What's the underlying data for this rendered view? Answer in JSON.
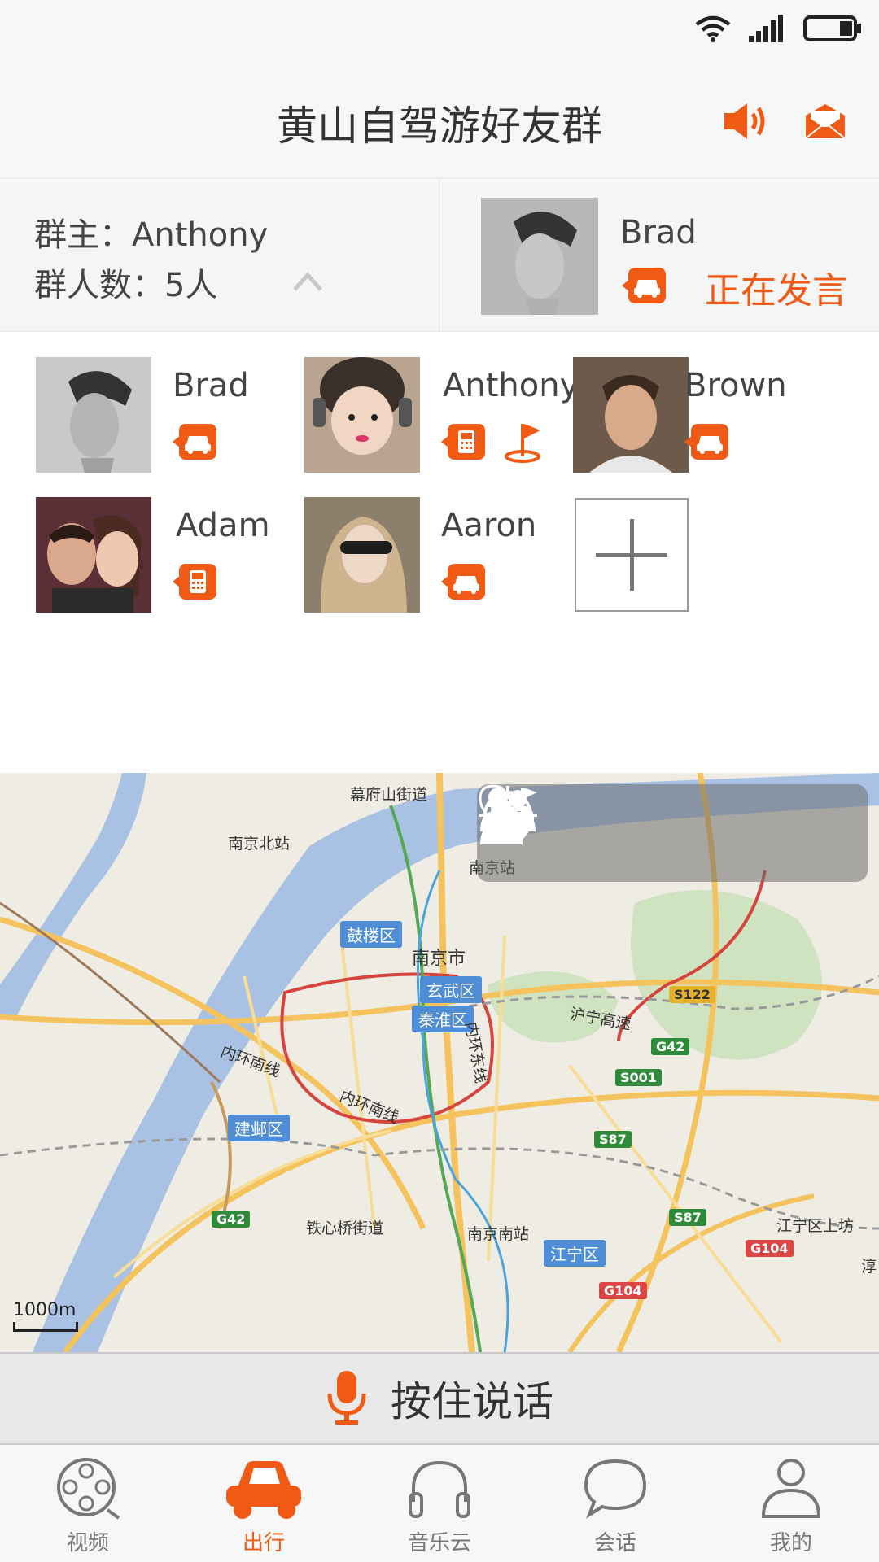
{
  "title": "黄山自驾游好友群",
  "group_info": {
    "owner_line": "群主：Anthony",
    "count_line": "群人数：5人"
  },
  "speaker": {
    "name": "Brad",
    "status": "正在发言",
    "mode_icon": "car-icon"
  },
  "members": [
    {
      "name": "Brad",
      "badges": [
        "car-icon"
      ],
      "avatar_color": "#8a8a8a"
    },
    {
      "name": "Anthony",
      "badges": [
        "phone-icon",
        "leader-flag-icon"
      ],
      "avatar_color": "#b79a7f"
    },
    {
      "name": "Brown",
      "badges": [
        "car-icon"
      ],
      "avatar_color": "#a57f62"
    },
    {
      "name": "Adam",
      "badges": [
        "phone-icon"
      ],
      "avatar_color": "#7a4f3c"
    },
    {
      "name": "Aaron",
      "badges": [
        "car-icon"
      ],
      "avatar_color": "#b3a07d"
    }
  ],
  "map": {
    "scale_label": "1000m",
    "labels": [
      "幕府山街道",
      "南京北站",
      "南京站",
      "南京市",
      "铁心桥街道",
      "南京南站",
      "江宁区上坊",
      "淳"
    ],
    "districts": [
      "鼓楼区",
      "玄武区",
      "秦淮区",
      "建邺区",
      "江宁区"
    ],
    "roads": [
      "S122",
      "G42",
      "S001",
      "S87",
      "G42",
      "S87",
      "G104",
      "G104"
    ],
    "road_names": [
      "沪宁高速",
      "内环南线",
      "内环东线",
      "内环南线"
    ],
    "tools": [
      "member-locations-icon",
      "group-icon",
      "locate-icon",
      "leader-icon"
    ]
  },
  "talk_button": {
    "label": "按住说话",
    "icon": "microphone-icon"
  },
  "tabs": [
    {
      "label": "视频",
      "icon": "film-reel-icon",
      "active": false
    },
    {
      "label": "出行",
      "icon": "car-icon",
      "active": true
    },
    {
      "label": "音乐云",
      "icon": "headphones-icon",
      "active": false
    },
    {
      "label": "会话",
      "icon": "chat-bubble-icon",
      "active": false
    },
    {
      "label": "我的",
      "icon": "person-icon",
      "active": false
    }
  ],
  "colors": {
    "accent": "#f05a14",
    "tab_inactive": "#777777",
    "map_tool_bg": "#6e6e6e"
  }
}
